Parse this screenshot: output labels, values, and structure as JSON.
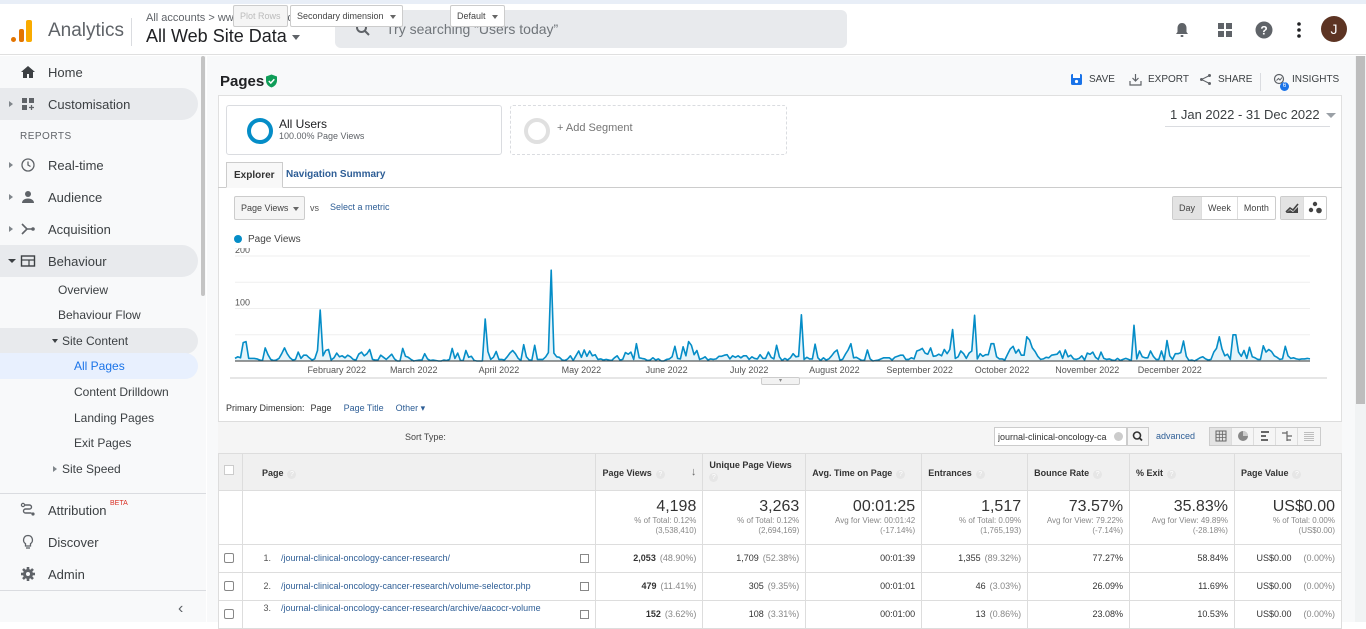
{
  "header": {
    "app_name": "Analytics",
    "breadcrumb": "All accounts > www.alliedacademies.o...",
    "property": "All Web Site Data",
    "search_placeholder": "Try searching “Users today”",
    "avatar_initial": "J",
    "icons": [
      "bell-icon",
      "apps-grid-icon",
      "help-icon",
      "more-vert-icon"
    ]
  },
  "sidebar": {
    "home": "Home",
    "customisation": "Customisation",
    "reports_label": "REPORTS",
    "realtime": "Real-time",
    "audience": "Audience",
    "acquisition": "Acquisition",
    "behaviour": "Behaviour",
    "behaviour_items": {
      "overview": "Overview",
      "behaviour_flow": "Behaviour Flow",
      "site_content": "Site Content",
      "all_pages": "All Pages",
      "content_drilldown": "Content Drilldown",
      "landing_pages": "Landing Pages",
      "exit_pages": "Exit Pages",
      "site_speed": "Site Speed"
    },
    "attribution": "Attribution",
    "attribution_badge": "BETA",
    "discover": "Discover",
    "admin": "Admin"
  },
  "report": {
    "title": "Pages",
    "actions": {
      "save": "SAVE",
      "export": "EXPORT",
      "share": "SHARE",
      "insights": "INSIGHTS",
      "insights_badge": "6"
    },
    "date_range": "1 Jan 2022 - 31 Dec 2022",
    "segments": {
      "all_users": "All Users",
      "all_users_sub": "100.00% Page Views",
      "add_segment": "+ Add Segment"
    },
    "tabs": {
      "explorer": "Explorer",
      "nav_summary": "Navigation Summary"
    },
    "metric": "Page Views",
    "vs": "vs",
    "select_metric": "Select a metric",
    "granularity": {
      "day": "Day",
      "week": "Week",
      "month": "Month",
      "selected": "Day"
    },
    "primary_dimension": {
      "label": "Primary Dimension:",
      "current": "Page",
      "page_title": "Page Title",
      "other": "Other"
    },
    "toolbar": {
      "plot_rows": "Plot Rows",
      "secondary_dimension": "Secondary dimension",
      "sort_type_label": "Sort Type:",
      "sort_type": "Default",
      "filter_value": "journal-clinical-oncology-ca",
      "advanced": "advanced"
    }
  },
  "table": {
    "columns": [
      "Page",
      "Page Views",
      "Unique Page Views",
      "Avg. Time on Page",
      "Entrances",
      "Bounce Rate",
      "% Exit",
      "Page Value"
    ],
    "totals": [
      {
        "value": "4,198",
        "line1": "% of Total: 0.12%",
        "line2": "(3,538,410)"
      },
      {
        "value": "3,263",
        "line1": "% of Total: 0.12%",
        "line2": "(2,694,169)"
      },
      {
        "value": "00:01:25",
        "line1": "Avg for View: 00:01:42",
        "line2": "(-17.14%)"
      },
      {
        "value": "1,517",
        "line1": "% of Total: 0.09%",
        "line2": "(1,765,193)"
      },
      {
        "value": "73.57%",
        "line1": "Avg for View: 79.22%",
        "line2": "(-7.14%)"
      },
      {
        "value": "35.83%",
        "line1": "Avg for View: 49.89%",
        "line2": "(-28.18%)"
      },
      {
        "value": "US$0.00",
        "line1": "% of Total: 0.00%",
        "line2": "(US$0.00)"
      }
    ],
    "rows": [
      {
        "num": "1.",
        "page": "/journal-clinical-oncology-cancer-research/",
        "pv": "2,053",
        "pv_pct": "(48.90%)",
        "upv": "1,709",
        "upv_pct": "(52.38%)",
        "avg_time": "00:01:39",
        "entr": "1,355",
        "entr_pct": "(89.32%)",
        "bounce": "77.27%",
        "exit": "58.84%",
        "value": "US$0.00",
        "value_pct": "(0.00%)"
      },
      {
        "num": "2.",
        "page": "/journal-clinical-oncology-cancer-research/volume-selector.php",
        "pv": "479",
        "pv_pct": "(11.41%)",
        "upv": "305",
        "upv_pct": "(9.35%)",
        "avg_time": "00:01:01",
        "entr": "46",
        "entr_pct": "(3.03%)",
        "bounce": "26.09%",
        "exit": "11.69%",
        "value": "US$0.00",
        "value_pct": "(0.00%)"
      },
      {
        "num": "3.",
        "page": "/journal-clinical-oncology-cancer-research/archive/aacocr-volume",
        "pv": "152",
        "pv_pct": "(3.62%)",
        "upv": "108",
        "upv_pct": "(3.31%)",
        "avg_time": "00:01:00",
        "entr": "13",
        "entr_pct": "(0.86%)",
        "bounce": "23.08%",
        "exit": "10.53%",
        "value": "US$0.00",
        "value_pct": "(0.00%)"
      }
    ]
  },
  "chart_data": {
    "type": "area",
    "title": "",
    "legend": [
      "Page Views"
    ],
    "legend_position": "top-left",
    "series_color": "#058dc7",
    "xlabel": "",
    "ylabel": "",
    "ylim": [
      0,
      200
    ],
    "yticks": [
      "100",
      "200"
    ],
    "x_range": [
      "2022-01-01",
      "2022-12-31"
    ],
    "xtick_labels": [
      "February 2022",
      "March 2022",
      "April 2022",
      "May 2022",
      "June 2022",
      "July 2022",
      "August 2022",
      "September 2022",
      "October 2022",
      "November 2022",
      "December 2022"
    ],
    "grid": true,
    "notable_points": [
      {
        "date": "2022-01-27",
        "value": 97
      },
      {
        "date": "2022-03-30",
        "value": 80
      },
      {
        "date": "2022-04-23",
        "value": 173
      },
      {
        "date": "2022-07-03",
        "value": 88
      },
      {
        "date": "2022-08-28",
        "value": 87
      }
    ],
    "values": [
      5,
      8,
      6,
      35,
      37,
      5,
      5,
      5,
      4,
      2,
      1,
      25,
      12,
      3,
      1,
      2,
      5,
      14,
      25,
      14,
      6,
      2,
      3,
      17,
      5,
      11,
      11,
      6,
      2,
      4,
      20,
      97,
      10,
      20,
      22,
      2,
      6,
      15,
      8,
      10,
      6,
      11,
      8,
      3,
      2,
      13,
      17,
      10,
      14,
      22,
      3,
      2,
      2,
      11,
      7,
      3,
      8,
      13,
      4,
      0,
      0,
      24,
      9,
      7,
      3,
      0,
      1,
      2,
      2,
      14,
      4,
      1,
      2,
      1,
      0,
      0,
      2,
      1,
      3,
      24,
      5,
      15,
      1,
      1,
      20,
      7,
      9,
      1,
      0,
      0,
      0,
      80,
      18,
      3,
      7,
      18,
      3,
      3,
      2,
      8,
      15,
      20,
      14,
      5,
      1,
      31,
      8,
      2,
      2,
      30,
      3,
      3,
      3,
      8,
      16,
      173,
      15,
      8,
      7,
      2,
      1,
      4,
      10,
      1,
      10,
      19,
      7,
      21,
      9,
      19,
      10,
      12,
      3,
      4,
      2,
      3,
      2,
      1,
      6,
      10,
      2,
      3,
      16,
      13,
      17,
      3,
      33,
      6,
      5,
      4,
      1,
      2,
      6,
      2,
      4,
      0,
      0,
      3,
      4,
      8,
      28,
      5,
      4,
      27,
      10,
      37,
      30,
      12,
      20,
      3,
      5,
      8,
      2,
      4,
      3,
      4,
      9,
      9,
      11,
      12,
      4,
      10,
      7,
      10,
      6,
      10,
      10,
      3,
      8,
      5,
      4,
      12,
      5,
      5,
      17,
      7,
      4,
      30,
      8,
      1,
      5,
      2,
      6,
      14,
      8,
      9,
      88,
      3,
      7,
      4,
      4,
      32,
      6,
      1,
      6,
      2,
      4,
      10,
      17,
      21,
      2,
      3,
      13,
      21,
      33,
      6,
      7,
      4,
      1,
      2,
      21,
      4,
      0,
      1,
      2,
      4,
      6,
      6,
      6,
      2,
      7,
      9,
      11,
      11,
      3,
      3,
      6,
      4,
      19,
      21,
      24,
      15,
      13,
      25,
      9,
      10,
      13,
      10,
      22,
      14,
      22,
      60,
      5,
      8,
      19,
      14,
      5,
      15,
      19,
      87,
      4,
      14,
      9,
      12,
      12,
      33,
      33,
      8,
      4,
      4,
      2,
      13,
      23,
      28,
      15,
      22,
      11,
      11,
      46,
      40,
      25,
      18,
      9,
      3,
      4,
      7,
      6,
      11,
      12,
      13,
      19,
      5,
      21,
      8,
      11,
      4,
      3,
      5,
      10,
      2,
      15,
      13,
      17,
      7,
      3,
      17,
      5,
      3,
      4,
      2,
      1,
      5,
      1,
      3,
      5,
      3,
      1,
      68,
      4,
      19,
      8,
      6,
      6,
      19,
      9,
      3,
      3,
      19,
      2,
      39,
      10,
      3,
      14,
      14,
      16,
      38,
      9,
      1,
      2,
      0,
      3,
      6,
      8,
      4,
      2,
      3,
      17,
      24,
      46,
      23,
      10,
      13,
      3,
      50,
      50,
      17,
      9,
      20,
      5,
      26,
      8,
      6,
      3,
      3,
      29,
      17,
      22,
      18,
      10,
      7,
      3,
      4,
      28,
      10,
      5,
      6,
      4,
      3,
      4,
      4,
      5,
      4
    ]
  }
}
